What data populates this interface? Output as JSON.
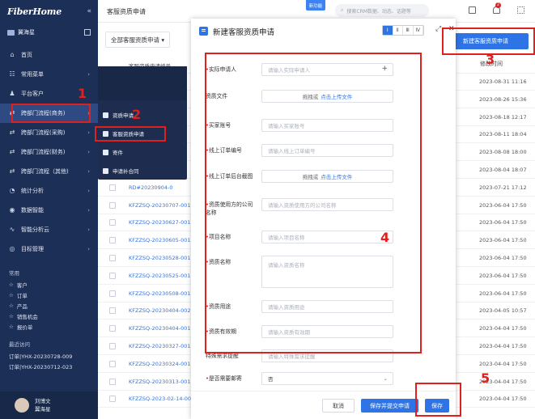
{
  "app": {
    "logo": "FiberHome",
    "collapse": "«"
  },
  "org": {
    "name": "翼海星"
  },
  "nav": [
    {
      "icon": "⌂",
      "label": "首页",
      "arrow": ""
    },
    {
      "icon": "☷",
      "label": "常用菜单",
      "arrow": "›"
    },
    {
      "icon": "♟",
      "label": "平台客户",
      "arrow": ""
    },
    {
      "icon": "⇄",
      "label": "跨部门流程(商务)",
      "arrow": "›"
    },
    {
      "icon": "⇄",
      "label": "跨部门流程(采购)",
      "arrow": "›"
    },
    {
      "icon": "⇄",
      "label": "跨部门流程(财务)",
      "arrow": "›"
    },
    {
      "icon": "⇄",
      "label": "跨部门流程（其他)",
      "arrow": "›"
    },
    {
      "icon": "◔",
      "label": "统计分析",
      "arrow": "›"
    },
    {
      "icon": "◉",
      "label": "数据智能",
      "arrow": "›"
    },
    {
      "icon": "∿",
      "label": "智能分析云",
      "arrow": "›"
    },
    {
      "icon": "◎",
      "label": "目标管理",
      "arrow": "›"
    }
  ],
  "common": {
    "title": "常用",
    "items": [
      "客户",
      "订单",
      "产品",
      "销售机会",
      "报价单"
    ]
  },
  "recent": {
    "title": "最近访问",
    "items": [
      "订单|YHX-20230728-009",
      "订单|YHX-20230712-023"
    ]
  },
  "user": {
    "name": "刘博文",
    "org": "翼海星"
  },
  "flyout": [
    "资质申请",
    "客服资质申请",
    "寄件",
    "申请补合同"
  ],
  "markers": {
    "m1": "1",
    "m2": "2",
    "m3": "3",
    "m4": "4",
    "m5": "5"
  },
  "topbar": {
    "page_title": "客服资质申请",
    "new_badge": "新功能",
    "search_placeholder": "搜索CRM数据、动态、话题等",
    "bell_count": "2"
  },
  "list": {
    "view_tab": "全部客服资质申请 ▾",
    "col_header": "修改时间",
    "new_button": "新建客服资质申请",
    "header_row": "客服资质申请编号",
    "rows": [
      {
        "id": "",
        "date": "2023-08-31 11:16"
      },
      {
        "id": "",
        "date": "2023-08-26 15:36"
      },
      {
        "id": "",
        "date": "2023-08-18 12:17"
      },
      {
        "id": "",
        "date": "2023-08-11 18:04"
      },
      {
        "id": "",
        "date": "2023-08-08 18:00"
      },
      {
        "id": "",
        "date": "2023-08-04 18:07"
      },
      {
        "id": "RD#20230904-0",
        "date": "2023-07-21 17:12"
      },
      {
        "id": "KFZZSQ-20230707-001",
        "date": "2023-06-04 17:50"
      },
      {
        "id": "KFZZSQ-20230627-001",
        "date": "2023-06-04 17:50"
      },
      {
        "id": "KFZZSQ-20230605-001",
        "date": "2023-06-04 17:50"
      },
      {
        "id": "KFZZSQ-20230528-001",
        "date": "2023-06-04 17:50"
      },
      {
        "id": "KFZZSQ-20230525-001",
        "date": "2023-06-04 17:50"
      },
      {
        "id": "KFZZSQ-20230508-001",
        "date": "2023-06-04 17:50"
      },
      {
        "id": "KFZZSQ-20230404-002",
        "date": "2023-04-05 10:57"
      },
      {
        "id": "KFZZSQ-20230404-001",
        "date": "2023-04-04 17:50"
      },
      {
        "id": "KFZZSQ-20230327-001",
        "date": "2023-04-04 17:50"
      },
      {
        "id": "KFZZSQ-20230324-001",
        "date": "2023-04-04 17:50"
      },
      {
        "id": "KFZZSQ-20230313-001",
        "date": "2023-04-04 17:50"
      },
      {
        "id": "KFZZSQ-2023-02-14-001",
        "date": "2023-04-04 17:50"
      }
    ]
  },
  "modal": {
    "title": "新建客服资质申请",
    "layout_options": [
      "Ⅰ",
      "Ⅱ",
      "Ⅲ",
      "Ⅳ"
    ],
    "fields": [
      {
        "label": "实际申请人",
        "required": true,
        "type": "input-plus",
        "placeholder": "请输入实际申请人"
      },
      {
        "label": "资质文件",
        "required": false,
        "type": "upload",
        "text": "拖拽或",
        "link": "点击上传文件"
      },
      {
        "label": "买家账号",
        "required": true,
        "type": "input",
        "placeholder": "请输入买家账号"
      },
      {
        "label": "线上订单编号",
        "required": true,
        "type": "input",
        "placeholder": "请输入线上订单编号"
      },
      {
        "label": "线上订单后台截图",
        "required": true,
        "type": "upload",
        "text": "拖拽或",
        "link": "点击上传文件"
      },
      {
        "label": "资质使用方的公司名称",
        "required": true,
        "type": "input",
        "placeholder": "请输入资质使用方的公司名称"
      },
      {
        "label": "项目名称",
        "required": true,
        "type": "input",
        "placeholder": "请输入项目名称"
      },
      {
        "label": "资质名称",
        "required": true,
        "type": "textarea",
        "placeholder": "请输入资质名称"
      },
      {
        "label": "资质用途",
        "required": true,
        "type": "input",
        "placeholder": "请输入资质用途"
      },
      {
        "label": "资质有效期",
        "required": true,
        "type": "input",
        "placeholder": "请输入资质有效期"
      },
      {
        "label": "特殊需求提醒",
        "required": false,
        "type": "input",
        "placeholder": "请输入特殊需求提醒"
      },
      {
        "label": "是否需要邮寄",
        "required": true,
        "type": "select",
        "value": "否"
      }
    ],
    "buttons": {
      "cancel": "取消",
      "save_submit": "保存并提交申请",
      "save": "保存"
    }
  },
  "colors": {
    "sidebar_bg": "#1c2f57",
    "primary": "#2e74e6",
    "marker_red": "#e0201d"
  }
}
